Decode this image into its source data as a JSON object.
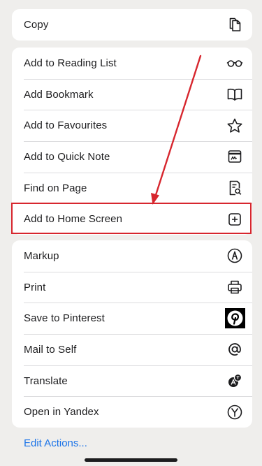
{
  "top_group": [
    {
      "label": "Copy",
      "icon": "copy-icon"
    }
  ],
  "middle_group": [
    {
      "label": "Add to Reading List",
      "icon": "glasses-icon"
    },
    {
      "label": "Add Bookmark",
      "icon": "book-icon"
    },
    {
      "label": "Add to Favourites",
      "icon": "star-icon"
    },
    {
      "label": "Add to Quick Note",
      "icon": "quick-note-icon"
    },
    {
      "label": "Find on Page",
      "icon": "find-on-page-icon"
    },
    {
      "label": "Add to Home Screen",
      "icon": "plus-square-icon"
    }
  ],
  "bottom_group": [
    {
      "label": "Markup",
      "icon": "markup-icon"
    },
    {
      "label": "Print",
      "icon": "printer-icon"
    },
    {
      "label": "Save to Pinterest",
      "icon": "pinterest-icon"
    },
    {
      "label": "Mail to Self",
      "icon": "at-icon"
    },
    {
      "label": "Translate",
      "icon": "translate-icon"
    },
    {
      "label": "Open in Yandex",
      "icon": "yandex-icon"
    }
  ],
  "edit_actions_label": "Edit Actions...",
  "annotation": {
    "highlighted_item": "Add to Home Screen",
    "highlight_color": "#d7262e"
  },
  "colors": {
    "background": "#efeeec",
    "link": "#1a73e8",
    "pinterest": "#000000"
  }
}
